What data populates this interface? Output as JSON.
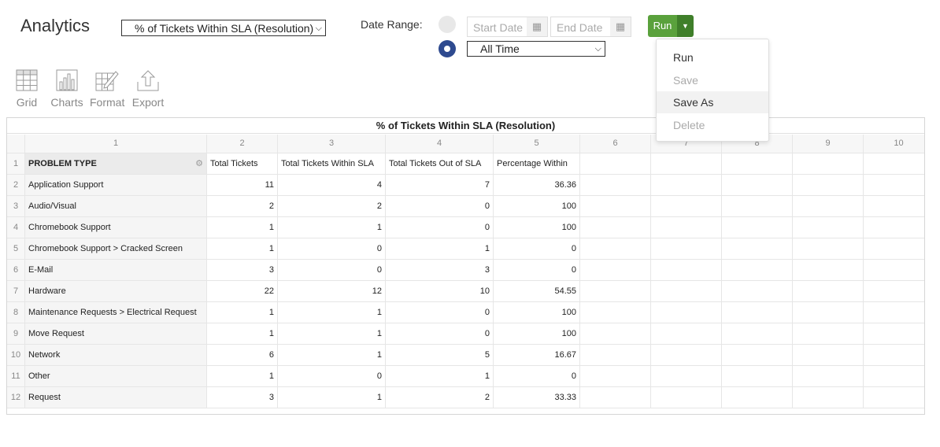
{
  "header": {
    "title": "Analytics",
    "report_select": "% of Tickets Within SLA (Resolution)",
    "date_range_label": "Date Range:",
    "start_date_placeholder": "Start Date",
    "end_date_placeholder": "End Date",
    "time_select": "All Time",
    "run_label": "Run"
  },
  "dropdown": {
    "items": [
      {
        "label": "Run",
        "enabled": true
      },
      {
        "label": "Save",
        "enabled": false
      },
      {
        "label": "Save As",
        "enabled": true
      },
      {
        "label": "Delete",
        "enabled": false
      }
    ]
  },
  "toolbar": {
    "grid": "Grid",
    "charts": "Charts",
    "format": "Format",
    "export": "Export"
  },
  "grid": {
    "title": "% of Tickets Within SLA (Resolution)",
    "column_numbers": [
      "1",
      "2",
      "3",
      "4",
      "5",
      "6",
      "7",
      "8",
      "9",
      "10"
    ],
    "headers": [
      "PROBLEM TYPE",
      "Total Tickets",
      "Total Tickets Within SLA",
      "Total Tickets Out of SLA",
      "Percentage Within"
    ],
    "rows": [
      {
        "num": "2",
        "type": "Application Support",
        "total": "11",
        "within": "4",
        "out": "7",
        "pct": "36.36"
      },
      {
        "num": "3",
        "type": "Audio/Visual",
        "total": "2",
        "within": "2",
        "out": "0",
        "pct": "100"
      },
      {
        "num": "4",
        "type": "Chromebook Support",
        "total": "1",
        "within": "1",
        "out": "0",
        "pct": "100"
      },
      {
        "num": "5",
        "type": "Chromebook Support > Cracked Screen",
        "total": "1",
        "within": "0",
        "out": "1",
        "pct": "0"
      },
      {
        "num": "6",
        "type": "E-Mail",
        "total": "3",
        "within": "0",
        "out": "3",
        "pct": "0"
      },
      {
        "num": "7",
        "type": "Hardware",
        "total": "22",
        "within": "12",
        "out": "10",
        "pct": "54.55"
      },
      {
        "num": "8",
        "type": "Maintenance Requests > Electrical Request",
        "total": "1",
        "within": "1",
        "out": "0",
        "pct": "100"
      },
      {
        "num": "9",
        "type": "Move Request",
        "total": "1",
        "within": "1",
        "out": "0",
        "pct": "100"
      },
      {
        "num": "10",
        "type": "Network",
        "total": "6",
        "within": "1",
        "out": "5",
        "pct": "16.67"
      },
      {
        "num": "11",
        "type": "Other",
        "total": "1",
        "within": "0",
        "out": "1",
        "pct": "0"
      },
      {
        "num": "12",
        "type": "Request",
        "total": "3",
        "within": "1",
        "out": "2",
        "pct": "33.33"
      }
    ]
  }
}
